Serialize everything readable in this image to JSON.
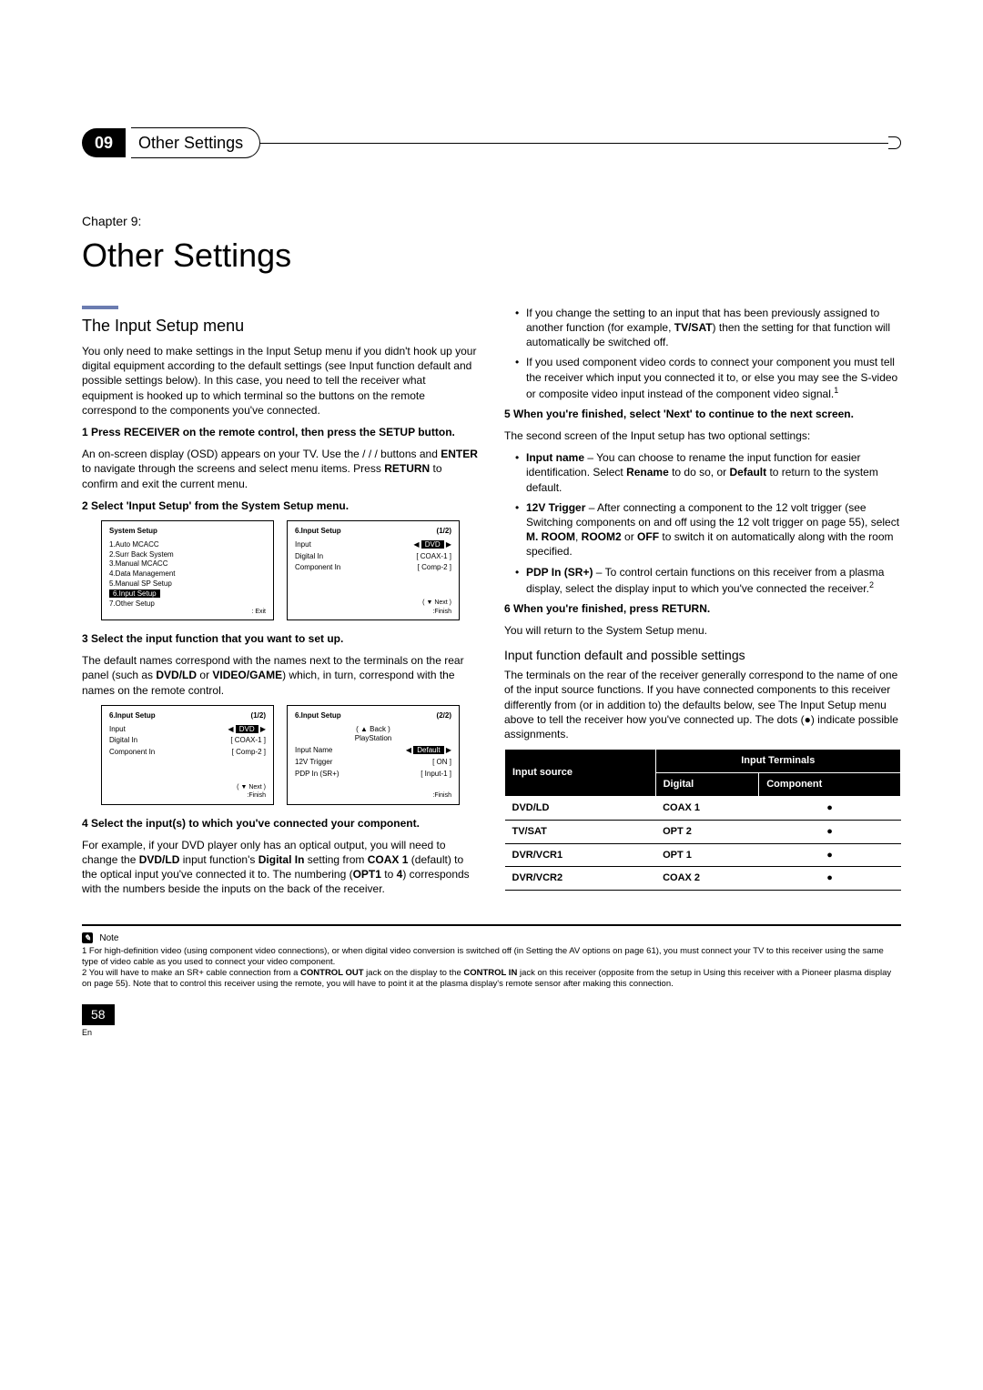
{
  "tab": {
    "num": "09",
    "title": "Other Settings"
  },
  "chapter": {
    "label": "Chapter 9:",
    "title": "Other Settings"
  },
  "section1": {
    "title": "The Input Setup menu",
    "intro": "You only need to make settings in the Input Setup menu if you didn't hook up your digital equipment according to the default settings (see Input function default and possible settings below). In this case, you need to tell the receiver what equipment is hooked up to which terminal so the buttons on the remote correspond to the components you've connected.",
    "step1hd": "1   Press RECEIVER on the remote control, then press the SETUP button.",
    "step1body_a": "An on-screen display (OSD) appears on your TV. Use the  ",
    "step1body_b": " /  /  /   buttons and ",
    "step1body_c": " to navigate through the screens and select menu items. Press ",
    "step1body_d": " to confirm and exit the current menu.",
    "enter": "ENTER",
    "return": "RETURN",
    "step2hd": "2   Select 'Input Setup' from the System Setup menu.",
    "step3hd": "3   Select the input function that you want to set up.",
    "step3body_a": "The default names correspond with the names next to the terminals on the rear panel (such as ",
    "step3body_b": " or ",
    "step3body_c": ") which, in turn, correspond with the names on the remote control.",
    "dvd_ld": "DVD/LD",
    "video_game": "VIDEO/GAME",
    "step4hd": "4   Select the input(s) to which you've connected your component.",
    "step4body_a": "For example, if your DVD player only has an optical output, you will need to change the ",
    "step4body_b": " input function's ",
    "step4body_c": " setting from ",
    "step4body_d": " (default) to the optical input you've connected it to. The numbering (",
    "step4body_e": " to ",
    "step4body_f": ") corresponds with the numbers beside the inputs on the back of the receiver.",
    "digital_in": "Digital In",
    "coax1": "COAX 1",
    "opt1": "OPT1",
    "four": "4"
  },
  "right": {
    "bull1_a": "If you change the setting to an input that has been previously assigned to another function (for example, ",
    "bull1_b": ") then the setting for that function will automatically be switched off.",
    "tvsat": "TV/SAT",
    "bull2": "If you used component video cords to connect your component you must tell the receiver which input you connected it to, or else you may see the S-video or composite video input instead of the component video signal.",
    "sup1": "1",
    "step5hd": "5   When you're finished, select 'Next' to continue to the next screen.",
    "step5body": "The second screen of the Input setup has two optional settings:",
    "bull3_a": "Input name",
    "bull3_b": " – You can choose to rename the input function for easier identification. Select ",
    "bull3_c": " to do so, or ",
    "bull3_d": " to return to the system default.",
    "rename": "Rename",
    "default": "Default",
    "bull4_a": "12V Trigger",
    "bull4_b": " – After connecting a component to the 12 volt trigger (see Switching components on and off using the 12 volt trigger on page 55), select ",
    "bull4_c": ", ",
    "bull4_d": " or ",
    "bull4_e": " to switch it on automatically along with the room specified.",
    "mroom": "M. ROOM",
    "room2": "ROOM2",
    "off": "OFF",
    "bull5_a": "PDP In (SR+)",
    "bull5_b": " – To control certain functions on this receiver from a plasma display, select the display input to which you've connected the receiver.",
    "sup2": "2",
    "step6hd": "6   When you're finished, press RETURN.",
    "step6body": "You will return to the System Setup menu.",
    "subhead": "Input function default and possible settings",
    "subbody": "The terminals on the rear of the receiver generally correspond to the name of one of the input source functions. If you have connected components to this receiver differently from (or in addition to) the defaults below, see The Input Setup menu above to tell the receiver how you've connected up. The dots (●) indicate possible assignments."
  },
  "osd": {
    "sys_title": "System  Setup",
    "sys_items": [
      "1.Auto  MCACC",
      "2.Surr  Back  System",
      "3.Manual  MCACC",
      "4.Data  Management",
      "5.Manual  SP  Setup",
      "6.Input  Setup",
      "7.Other  Setup"
    ],
    "sys_exit": ": Exit",
    "in_title": "6.Input  Setup",
    "pg12": "(1/2)",
    "pg22": "(2/2)",
    "row_input": "Input",
    "val_dvd": "DVD",
    "row_digin": "Digital  In",
    "val_coax1": "[  COAX-1   ]",
    "row_comp": "Component In",
    "val_comp2": "[  Comp-2   ]",
    "next": "( ▼ Next )",
    "finish": ":Finish",
    "back": "( ▲ Back )",
    "ps": "PlayStation",
    "row_name": "Input  Name",
    "val_default": "Default",
    "row_12v": "12V  Trigger",
    "val_on": "[     ON      ]",
    "row_pdp": "PDP  In (SR+)",
    "val_in1": "[  Input-1  ]"
  },
  "table": {
    "h_source": "Input source",
    "h_terms": "Input Terminals",
    "h_dig": "Digital",
    "h_comp": "Component",
    "rows": [
      {
        "src": "DVD/LD",
        "dig": "COAX 1",
        "dot": "●"
      },
      {
        "src": "TV/SAT",
        "dig": "OPT 2",
        "dot": "●"
      },
      {
        "src": "DVR/VCR1",
        "dig": "OPT 1",
        "dot": "●"
      },
      {
        "src": "DVR/VCR2",
        "dig": "COAX 2",
        "dot": "●"
      }
    ]
  },
  "notes": {
    "label": "Note",
    "n1": "1 For high-definition video (using component video connections), or when digital video conversion is switched off (in Setting the AV options on page 61), you must connect your TV to this receiver using the same type of video cable as you used to connect your video component.",
    "n2_a": "2 You will have to make an SR+ cable connection from a ",
    "n2_b": " jack on the display to the ",
    "n2_c": " jack on this receiver (opposite from the setup in Using this receiver with a Pioneer plasma display on page 55). Note that to control this receiver using the remote, you will have to point it at the plasma display's remote sensor after making this connection.",
    "ctrl_out": "CONTROL OUT",
    "ctrl_in": "CONTROL IN"
  },
  "page": {
    "num": "58",
    "lang": "En"
  }
}
